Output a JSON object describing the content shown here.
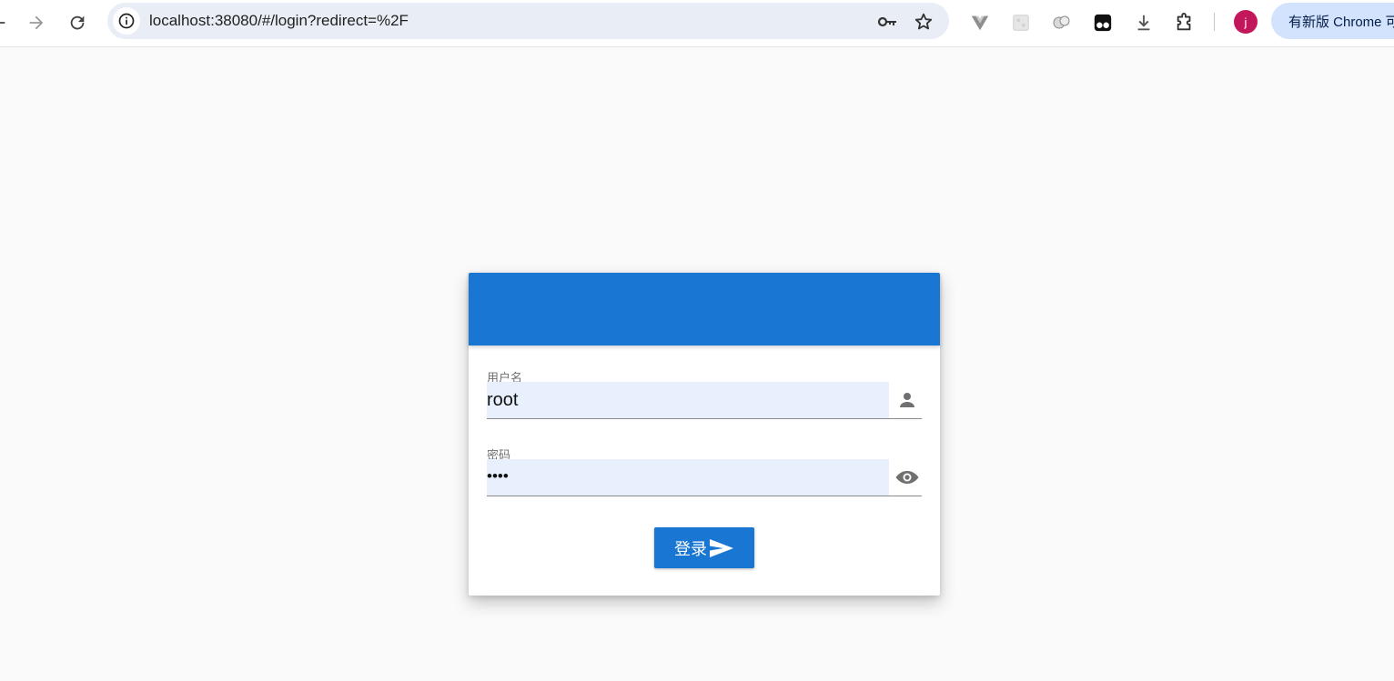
{
  "browser": {
    "url": "localhost:38080/#/login?redirect=%2F",
    "profile_initial": "j",
    "update_label": "有新版 Chrome 可用"
  },
  "login": {
    "username_label": "用户名",
    "username_value": "root",
    "password_label": "密码",
    "password_value": "••••",
    "submit_label": "登录"
  },
  "icons": {
    "back": "back-arrow-icon",
    "forward": "forward-arrow-icon",
    "reload": "reload-icon",
    "site_info": "site-info-icon",
    "password_key": "key-icon",
    "bookmark": "star-icon",
    "user": "person-icon",
    "password_visibility": "eye-icon",
    "send": "send-icon"
  },
  "colors": {
    "primary": "#1976d2",
    "input_autofill": "#e8f0fe",
    "page_background": "#fafafa"
  }
}
